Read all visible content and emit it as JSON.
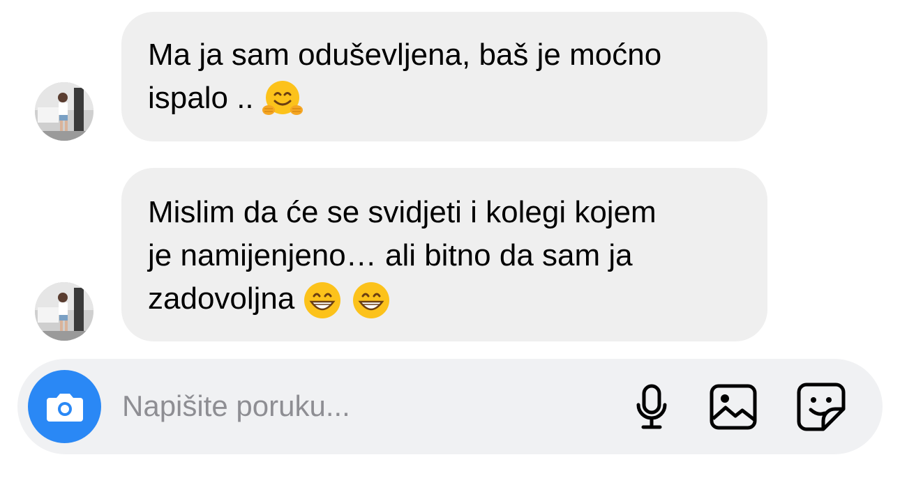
{
  "messages": [
    {
      "lines": [
        "Ma ja sam oduševljena, baš je moćno",
        "ispalo .."
      ],
      "emoji": [
        "hugging-face-emoji"
      ]
    },
    {
      "lines": [
        "Mislim da će se svidjeti i kolegi kojem",
        "je namijenjeno… ali bitno da sam ja",
        "zadovoljna"
      ],
      "emoji": [
        "grinning-face-emoji",
        "grinning-face-emoji"
      ]
    }
  ],
  "composer": {
    "placeholder": "Napišite poruku...",
    "value": ""
  },
  "icons": {
    "camera": "camera-icon",
    "mic": "microphone-icon",
    "gallery": "image-icon",
    "sticker": "sticker-icon"
  },
  "colors": {
    "bubble_bg": "#efefef",
    "composer_bg": "#f0f1f3",
    "camera_accent": "#2a88f5",
    "placeholder_text": "#8e8e93"
  }
}
